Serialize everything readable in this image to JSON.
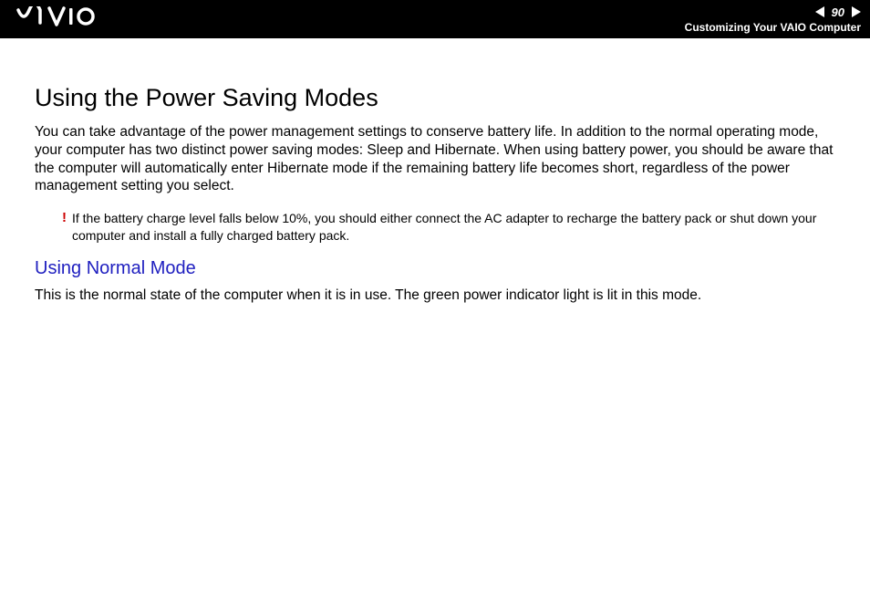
{
  "header": {
    "logo_text": "VAIO",
    "page_number": "90",
    "breadcrumb": "Customizing Your VAIO Computer"
  },
  "content": {
    "heading": "Using the Power Saving Modes",
    "intro": "You can take advantage of the power management settings to conserve battery life. In addition to the normal operating mode, your computer has two distinct power saving modes: Sleep and Hibernate. When using battery power, you should be aware that the computer will automatically enter Hibernate mode if the remaining battery life becomes short, regardless of the power management setting you select.",
    "warning": {
      "icon": "!",
      "text": "If the battery charge level falls below 10%, you should either connect the AC adapter to recharge the battery pack or shut down your computer and install a fully charged battery pack."
    },
    "sub_heading": "Using Normal Mode",
    "sub_body": "This is the normal state of the computer when it is in use. The green power indicator light is lit in this mode."
  }
}
